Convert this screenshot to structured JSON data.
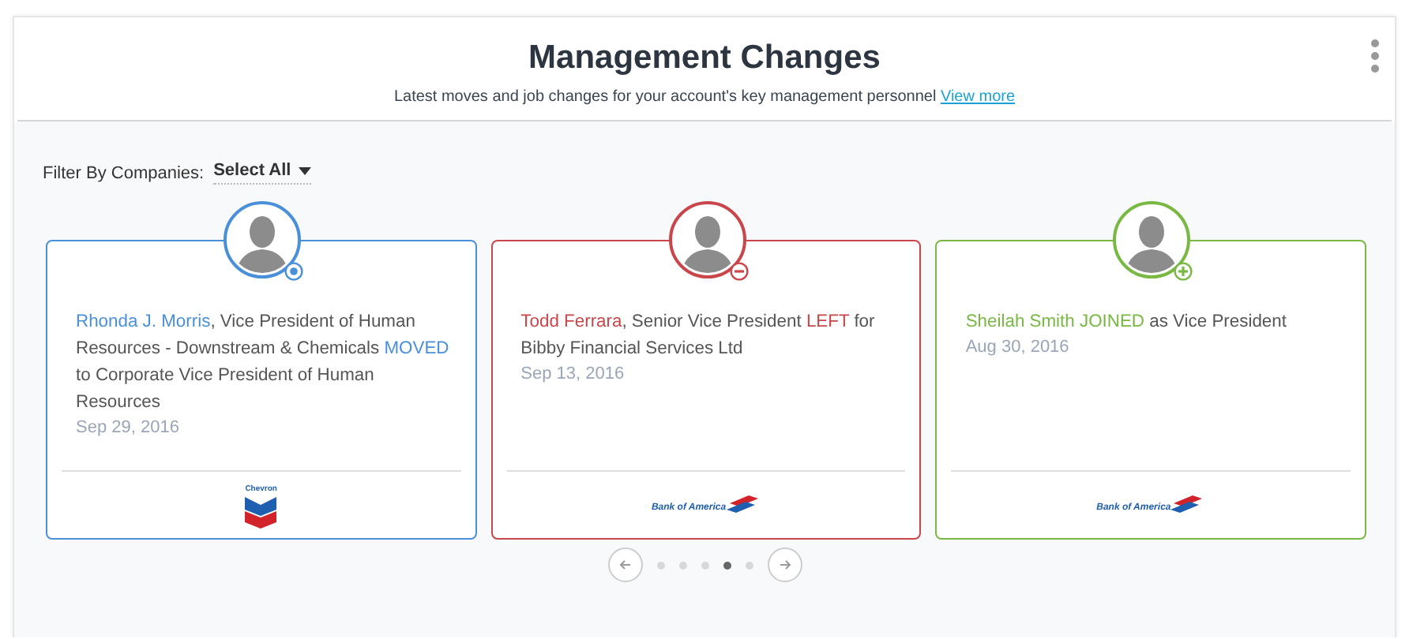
{
  "header": {
    "title": "Management Changes",
    "subtitle": "Latest moves and job changes for your account's key management personnel",
    "link": "View more"
  },
  "filter": {
    "label": "Filter By Companies:",
    "value": "Select All"
  },
  "cards": [
    {
      "kind": "moved",
      "segments": [
        {
          "text": "Rhonda J. Morris",
          "accent": true
        },
        {
          "text": ", Vice President of Human Resources - Downstream & Chemicals ",
          "accent": false
        },
        {
          "text": "MOVED",
          "accent": true
        },
        {
          "text": " to Corporate Vice President of Human Resources",
          "accent": false
        }
      ],
      "date": "Sep 29, 2016",
      "logo": {
        "kind": "chevron",
        "text": "Chevron"
      }
    },
    {
      "kind": "left",
      "segments": [
        {
          "text": "Todd Ferrara",
          "accent": true
        },
        {
          "text": ", Senior Vice President ",
          "accent": false
        },
        {
          "text": "LEFT",
          "accent": true
        },
        {
          "text": " for Bibby Financial Services Ltd",
          "accent": false
        }
      ],
      "date": "Sep 13, 2016",
      "logo": {
        "kind": "bofa",
        "text": "Bank of America"
      }
    },
    {
      "kind": "joined",
      "segments": [
        {
          "text": "Sheilah Smith JOINED",
          "accent": true
        },
        {
          "text": " as Vice President",
          "accent": false
        }
      ],
      "date": "Aug 30, 2016",
      "logo": {
        "kind": "bofa",
        "text": "Bank of America"
      }
    }
  ],
  "pager": {
    "pages": [
      {
        "selected": false
      },
      {
        "selected": false
      },
      {
        "selected": false
      },
      {
        "selected": true
      },
      {
        "selected": false
      }
    ]
  }
}
